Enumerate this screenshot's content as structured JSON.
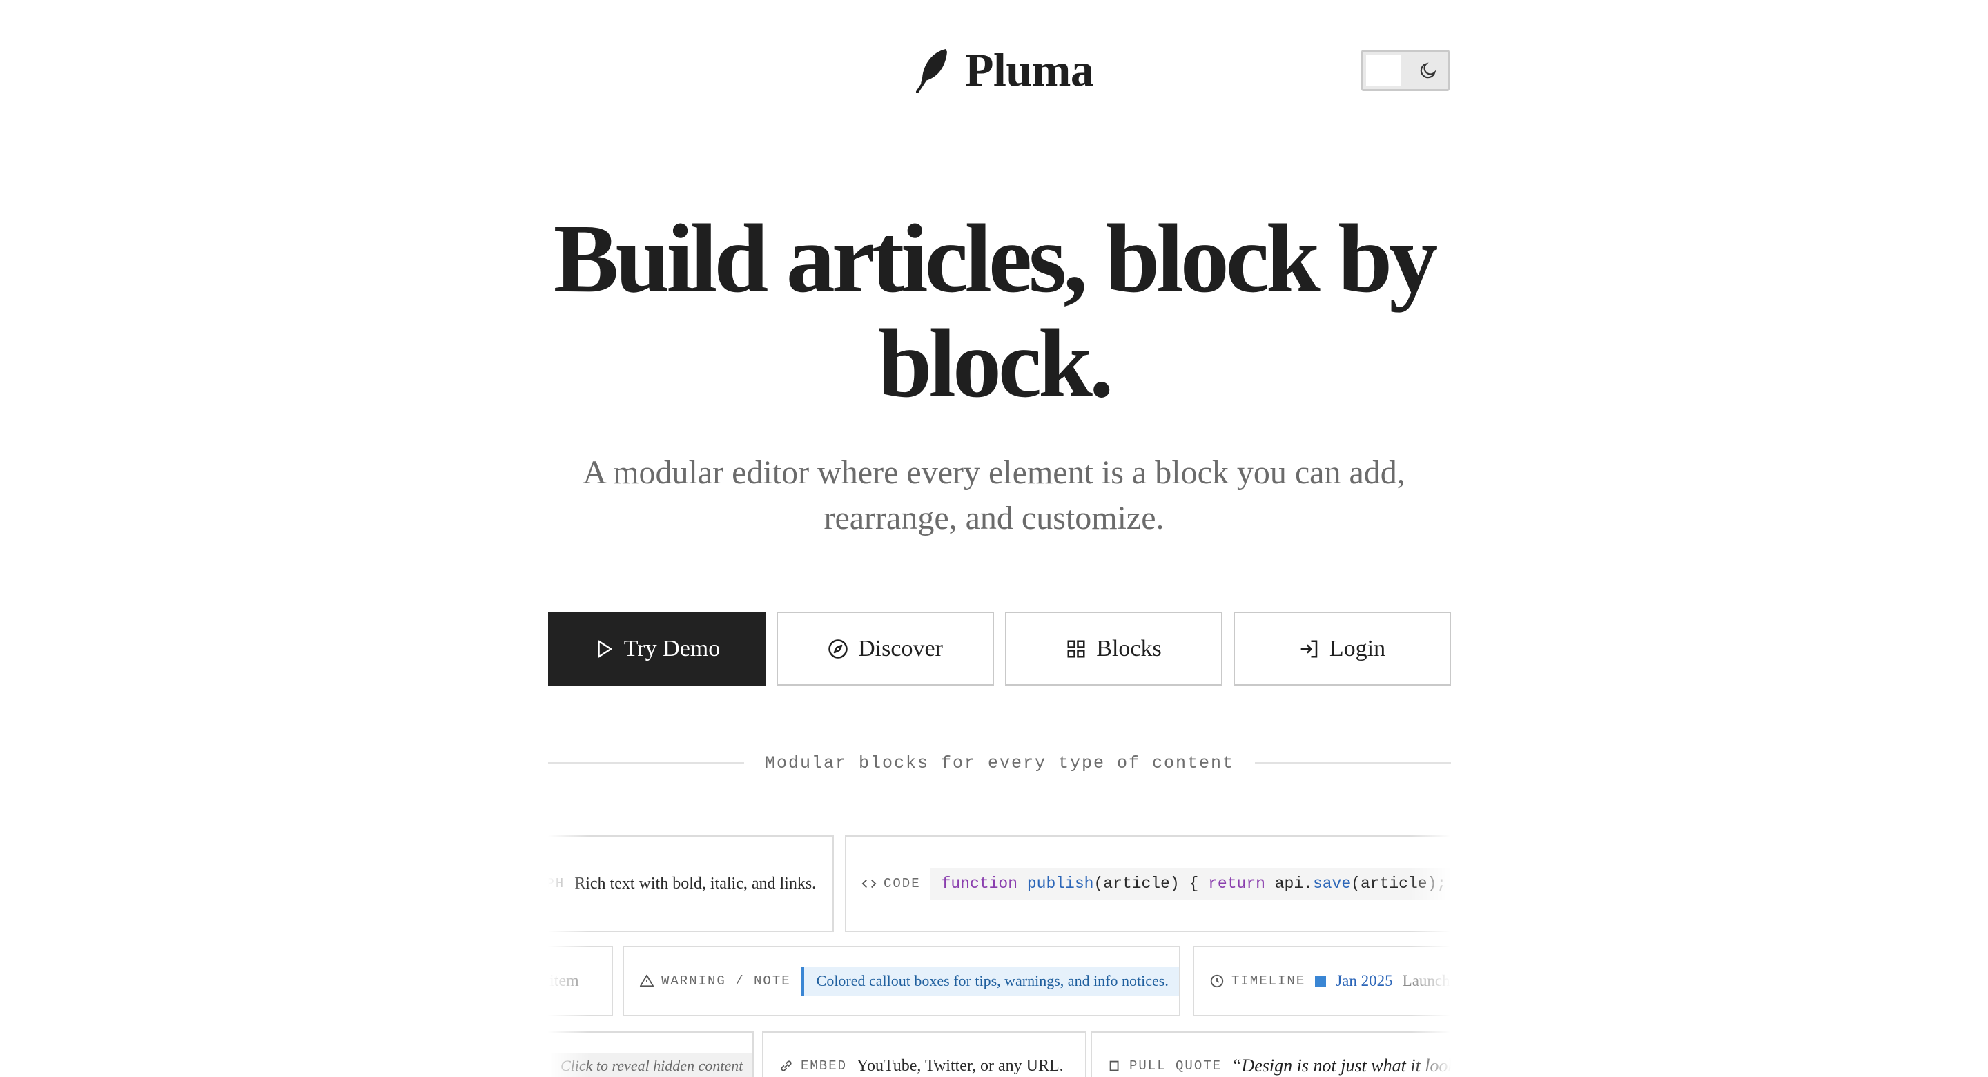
{
  "brand": {
    "name": "Pluma",
    "logo_icon": "feather-icon"
  },
  "theme_toggle": {
    "state": "light",
    "icon": "moon-icon"
  },
  "hero": {
    "title": "Build articles, block by block.",
    "subtitle": "A modular editor where every element is a block you can add, rearrange, and customize."
  },
  "actions": [
    {
      "label": "Try Demo",
      "icon": "play-icon",
      "primary": true
    },
    {
      "label": "Discover",
      "icon": "compass-icon",
      "primary": false
    },
    {
      "label": "Blocks",
      "icon": "grid-icon",
      "primary": false
    },
    {
      "label": "Login",
      "icon": "login-icon",
      "primary": false
    }
  ],
  "section_label": "Modular blocks for every type of content",
  "blocks": {
    "paragraph": {
      "tag": "APH",
      "text": "Rich text with bold, italic, and links."
    },
    "code": {
      "tag": "CODE",
      "tokens": [
        "function",
        " ",
        "publish",
        "(article) { ",
        "return",
        " api.",
        "save",
        "(article);"
      ]
    },
    "list": {
      "text": "d item"
    },
    "callout": {
      "tag": "WARNING / NOTE",
      "text": "Colored callout boxes for tips, warnings, and info notices."
    },
    "timeline": {
      "tag": "TIMELINE",
      "date": "Jan 2025",
      "event": "Launch"
    },
    "spoiler": {
      "text": "Click to reveal hidden content"
    },
    "embed": {
      "tag": "EMBED",
      "text": "YouTube, Twitter, or any URL."
    },
    "pullquote": {
      "tag": "PULL QUOTE",
      "text": "“Design is not just what it looks"
    }
  },
  "colors": {
    "primary_button": "#222222",
    "accent_blue": "#3a86d4",
    "keyword_purple": "#8a3fae"
  }
}
